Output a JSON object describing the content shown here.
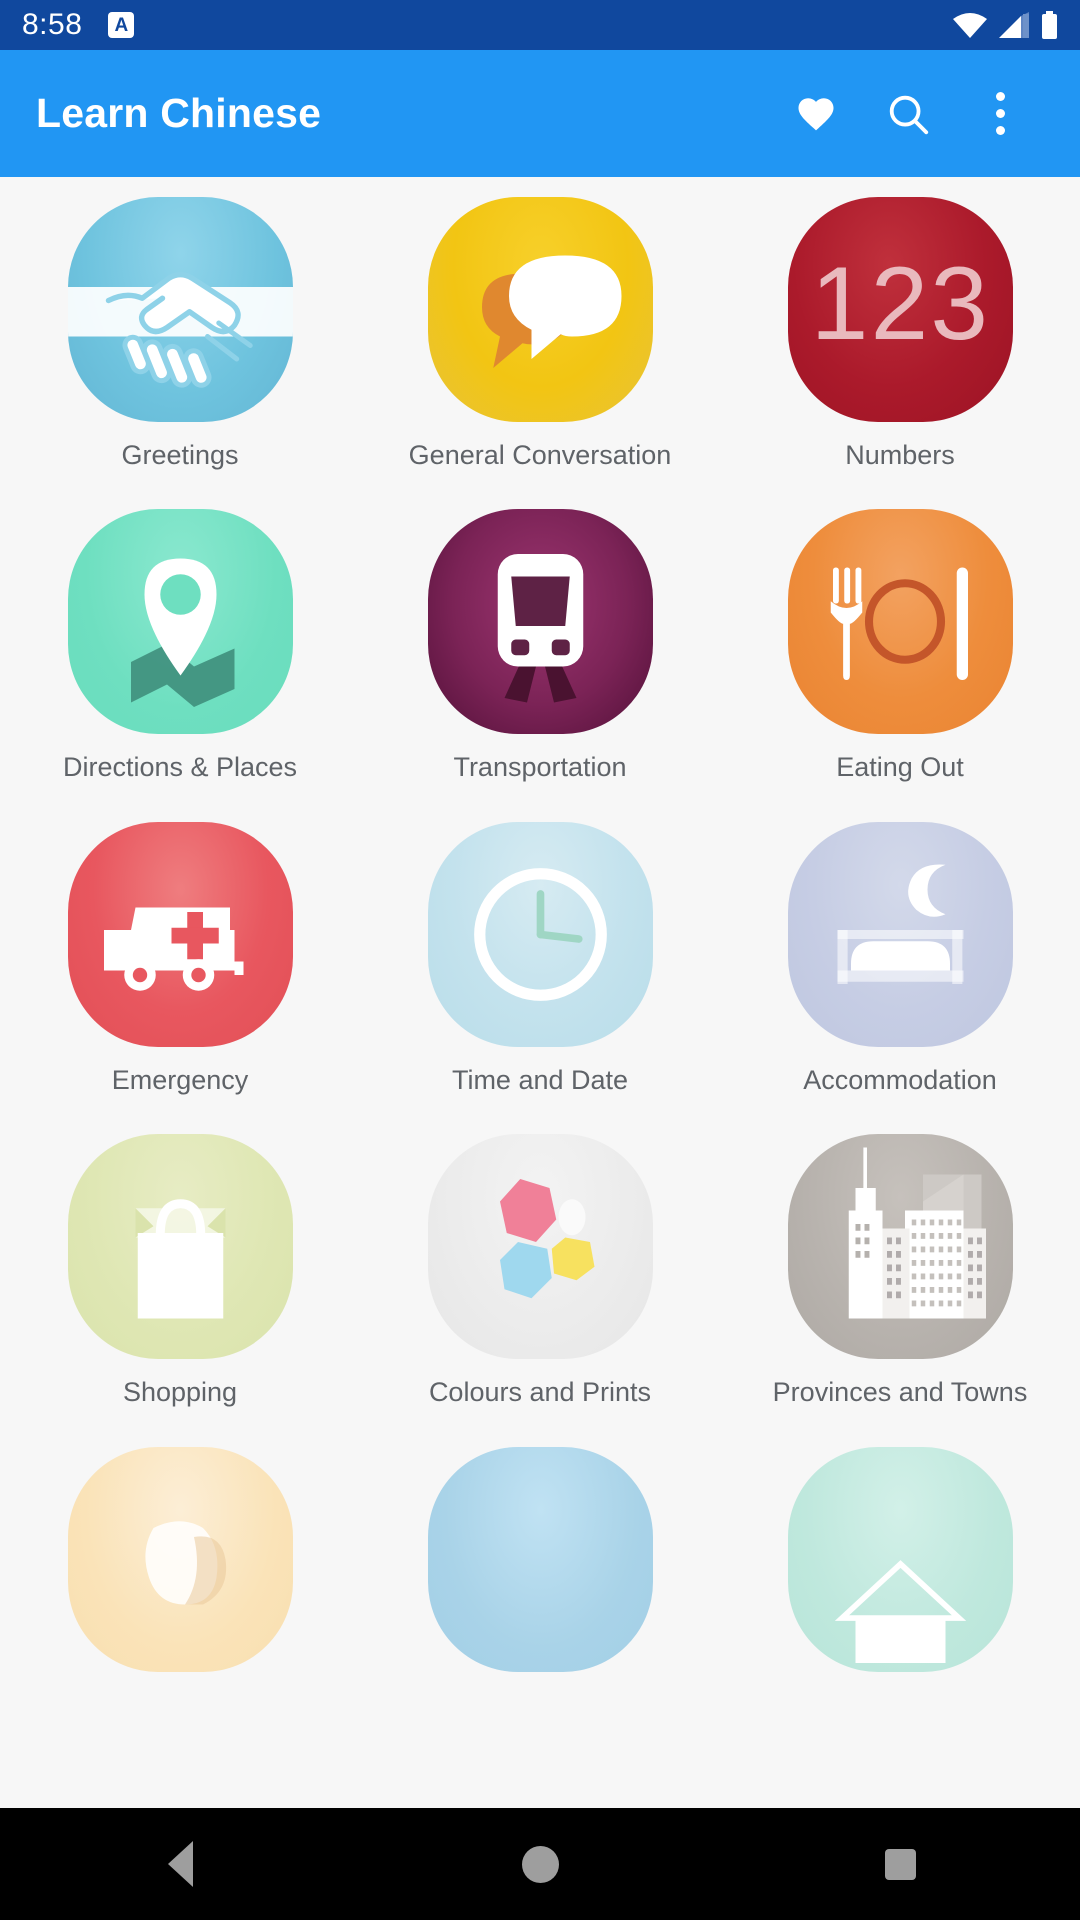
{
  "status_bar": {
    "time": "8:58",
    "notification_badge": "A",
    "icons": [
      "wifi-icon",
      "cell-signal-icon",
      "battery-icon"
    ],
    "background_color": "#10489e"
  },
  "app_bar": {
    "title": "Learn Chinese",
    "background_color": "#2196f3",
    "actions": [
      {
        "name": "favorites-button",
        "icon": "heart-icon",
        "label": "Favorites"
      },
      {
        "name": "search-button",
        "icon": "search-icon",
        "label": "Search"
      },
      {
        "name": "overflow-menu-button",
        "icon": "more-vert-icon",
        "label": "More options"
      }
    ]
  },
  "content": {
    "background_color": "#f7f7f7",
    "categories": [
      {
        "label": "Greetings",
        "icon": "handshake-icon",
        "color_start": "#7ccfe3",
        "color_end": "#8fd4ea",
        "accent": "#ffffff"
      },
      {
        "label": "General Conversation",
        "icon": "speech-bubbles-icon",
        "color_start": "#f5c518",
        "color_end": "#efd23c",
        "accent": "#e08b36"
      },
      {
        "label": "Numbers",
        "icon": "123-icon",
        "color_start": "#a51426",
        "color_end": "#c9333f",
        "accent": "#e8b7bb"
      },
      {
        "label": "Directions & Places",
        "icon": "map-pin-icon",
        "color_start": "#6fe0c0",
        "color_end": "#8ae8cf",
        "accent": "#3f8f7c"
      },
      {
        "label": "Transportation",
        "icon": "train-icon",
        "color_start": "#5e1040",
        "color_end": "#9c3570",
        "accent": "#ffffff"
      },
      {
        "label": "Eating Out",
        "icon": "cutlery-icon",
        "color_start": "#ef8e3c",
        "color_end": "#f2a05a",
        "accent": "#c9562a"
      },
      {
        "label": "Emergency",
        "icon": "ambulance-icon",
        "color_start": "#e8575f",
        "color_end": "#ef7a7c",
        "accent": "#ffffff"
      },
      {
        "label": "Time and Date",
        "icon": "clock-icon",
        "color_start": "#cfe7ef",
        "color_end": "#bfe0ea",
        "accent": "#ffffff"
      },
      {
        "label": "Accommodation",
        "icon": "bed-moon-icon",
        "color_start": "#ccd3e6",
        "color_end": "#c2cbe2",
        "accent": "#ffffff"
      },
      {
        "label": "Shopping",
        "icon": "shopping-bag-icon",
        "color_start": "#e3e9bc",
        "color_end": "#dde6b3",
        "accent": "#ffffff"
      },
      {
        "label": "Colours and Prints",
        "icon": "colour-swatches-icon",
        "color_start": "#efefef",
        "color_end": "#e8e8e8",
        "accent": "#f08098"
      },
      {
        "label": "Provinces and Towns",
        "icon": "cityscape-icon",
        "color_start": "#b5b0ab",
        "color_end": "#c9c4bf",
        "accent": "#ffffff"
      }
    ],
    "partial_row": [
      {
        "icon": "dog-icon",
        "color_start": "#fae3b8",
        "color_end": "#fbeacd"
      },
      {
        "icon": "weather-icon",
        "color_start": "#a9d3e8",
        "color_end": "#bcdff0"
      },
      {
        "icon": "house-icon",
        "color_start": "#bfe8dd",
        "color_end": "#cdeee6"
      }
    ]
  },
  "nav_bar": {
    "background_color": "#000000",
    "buttons": [
      {
        "name": "nav-back-button",
        "label": "Back"
      },
      {
        "name": "nav-home-button",
        "label": "Home"
      },
      {
        "name": "nav-recents-button",
        "label": "Recents"
      }
    ]
  }
}
